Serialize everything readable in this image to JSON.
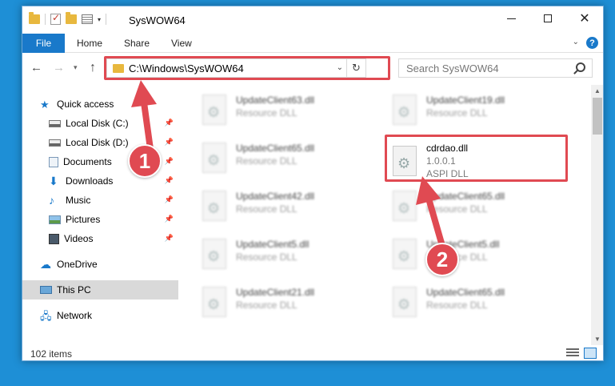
{
  "window": {
    "title": "SysWOW64",
    "ribbon_tabs": {
      "file": "File",
      "home": "Home",
      "share": "Share",
      "view": "View"
    },
    "help": "?"
  },
  "nav": {
    "address": "C:\\Windows\\SysWOW64",
    "search_placeholder": "Search SysWOW64"
  },
  "sidebar": {
    "items": [
      {
        "label": "Quick access",
        "icon": "star-icon",
        "pinned": false
      },
      {
        "label": "Local Disk (C:)",
        "icon": "drive-icon",
        "pinned": true
      },
      {
        "label": "Local Disk (D:)",
        "icon": "drive-icon",
        "pinned": true
      },
      {
        "label": "Documents",
        "icon": "documents-icon",
        "pinned": true
      },
      {
        "label": "Downloads",
        "icon": "downloads-icon",
        "pinned": true
      },
      {
        "label": "Music",
        "icon": "music-icon",
        "pinned": true
      },
      {
        "label": "Pictures",
        "icon": "pictures-icon",
        "pinned": true
      },
      {
        "label": "Videos",
        "icon": "videos-icon",
        "pinned": true
      },
      {
        "label": "OneDrive",
        "icon": "onedrive-icon",
        "pinned": false
      },
      {
        "label": "This PC",
        "icon": "pc-icon",
        "pinned": false,
        "selected": true
      },
      {
        "label": "Network",
        "icon": "network-icon",
        "pinned": false
      }
    ]
  },
  "files": {
    "left": [
      {
        "name": "UpdateClient63.dll",
        "type": "Resource DLL"
      },
      {
        "name": "UpdateClient65.dll",
        "type": "Resource DLL"
      },
      {
        "name": "UpdateClient42.dll",
        "type": "Resource DLL"
      },
      {
        "name": "UpdateClient5.dll",
        "type": "Resource DLL"
      },
      {
        "name": "UpdateClient21.dll",
        "type": "Resource DLL"
      }
    ],
    "right": [
      {
        "name": "UpdateClient19.dll",
        "type": "Resource DLL"
      },
      {
        "name": "cdrdao.dll",
        "version": "1.0.0.1",
        "type": "ASPI DLL",
        "highlighted": true
      },
      {
        "name": "UpdateClient65.dll",
        "type": "Resource DLL"
      },
      {
        "name": "UpdateClient5.dll",
        "type": "Resource DLL"
      },
      {
        "name": "UpdateClient65.dll",
        "type": "Resource DLL"
      }
    ]
  },
  "status": {
    "item_count": "102 items"
  },
  "annotations": {
    "badge1": "1",
    "badge2": "2",
    "color": "#e04a52"
  }
}
